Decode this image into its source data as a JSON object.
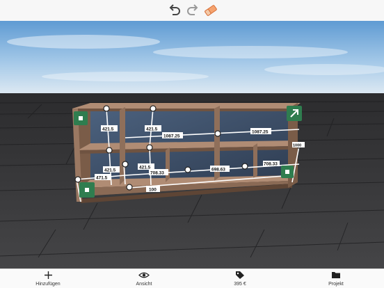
{
  "toolbar": {
    "undo_icon": "undo-icon",
    "redo_icon": "redo-icon",
    "eraser_icon": "eraser-icon",
    "colors": {
      "undo": "#444444",
      "redo": "#9a9a9a",
      "eraser": "#f08a4b"
    }
  },
  "dimensions": {
    "upper_left_height": "421.5",
    "upper_mid_height": "421.5",
    "lower_left_height": "421.5",
    "lower_mid_height": "421.5",
    "left_depth": "471.5",
    "top_width": "1087.25",
    "shelf_width": "1087.25",
    "middle_shelf_left": "708.33",
    "middle_shelf_mid": "698.63",
    "middle_shelf_right": "708.33",
    "total_height": "1000",
    "bottom": "100"
  },
  "nav": {
    "add_label": "Hinzufügen",
    "view_label": "Ansicht",
    "price_label": "395 €",
    "project_label": "Projekt"
  },
  "colors": {
    "accent_green": "#2f7d4f",
    "shelf_wood": "#8a6a55",
    "floor": "#3a3a3a",
    "sky": "#9fc6e8"
  }
}
